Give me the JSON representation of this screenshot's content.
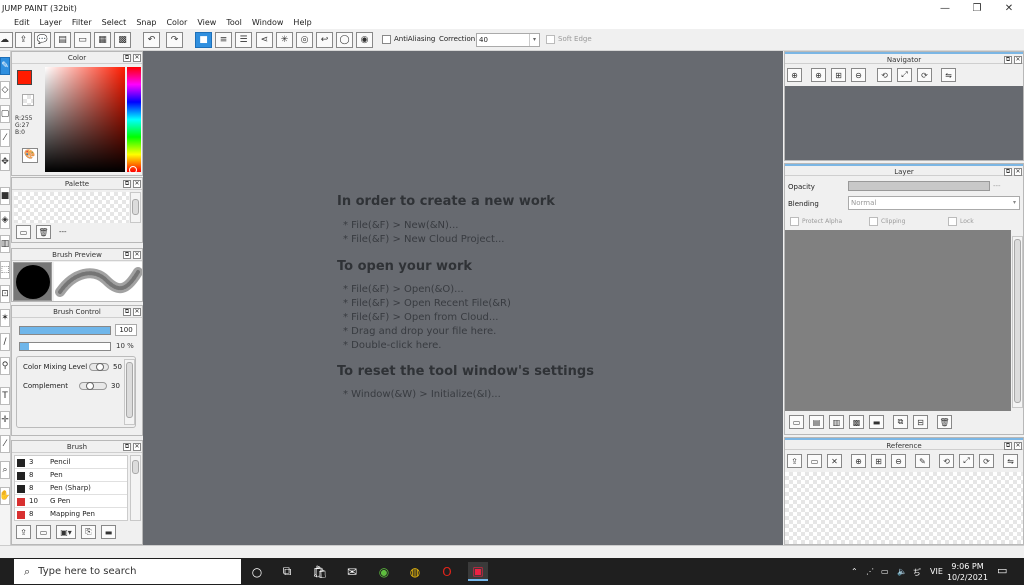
{
  "window": {
    "title": "JUMP PAINT (32bit)",
    "controls": [
      "—",
      "❐",
      "✕"
    ]
  },
  "menu": [
    "Edit",
    "Layer",
    "Filter",
    "Select",
    "Snap",
    "Color",
    "View",
    "Tool",
    "Window",
    "Help"
  ],
  "toolbar": {
    "antialiasing_label": "AntiAliasing",
    "correction_label": "Correction",
    "correction_value": "40",
    "soft_edge_label": "Soft Edge"
  },
  "color_panel": {
    "title": "Color",
    "rgb": {
      "r": "R:255",
      "g": "G:27",
      "b": "B:0"
    },
    "fg_color": "#ff1b00"
  },
  "palette_panel": {
    "title": "Palette",
    "menu_text": "---"
  },
  "brush_preview_panel": {
    "title": "Brush Preview"
  },
  "brush_control_panel": {
    "title": "Brush Control",
    "size_value": "100",
    "size_fill": 1.0,
    "opacity_value": "10 %",
    "opacity_fill": 0.1,
    "color_mixing_label": "Color Mixing Level",
    "color_mixing_value": "50",
    "color_mixing_level": 0.5,
    "complement_label": "Complement",
    "complement_value": "30",
    "complement_level": 0.3
  },
  "brush_panel": {
    "title": "Brush",
    "items": [
      {
        "size": "3",
        "name": "Pencil",
        "color": "#222222"
      },
      {
        "size": "8",
        "name": "Pen",
        "color": "#222222"
      },
      {
        "size": "8",
        "name": "Pen (Sharp)",
        "color": "#222222"
      },
      {
        "size": "10",
        "name": "G Pen",
        "color": "#d83030"
      },
      {
        "size": "8",
        "name": "Mapping Pen",
        "color": "#d83030"
      }
    ]
  },
  "canvas_help": {
    "heading1": "In order to create a new work",
    "items1": [
      "* File(&F) > New(&N)...",
      "* File(&F) > New Cloud Project..."
    ],
    "heading2": "To open your work",
    "items2": [
      "* File(&F) > Open(&O)...",
      "* File(&F) > Open Recent File(&R)",
      "* File(&F) > Open from Cloud...",
      "* Drag and drop your file here.",
      "* Double-click here."
    ],
    "heading3": "To reset the tool window's settings",
    "items3": [
      "* Window(&W) > Initialize(&I)..."
    ]
  },
  "navigator_panel": {
    "title": "Navigator"
  },
  "layer_panel": {
    "title": "Layer",
    "opacity_label": "Opacity",
    "opacity_value": "---",
    "blending_label": "Blending",
    "blending_value": "Normal",
    "protect_alpha_label": "Protect Alpha",
    "clipping_label": "Clipping",
    "lock_label": "Lock"
  },
  "reference_panel": {
    "title": "Reference"
  },
  "taskbar": {
    "search_placeholder": "Type here to search",
    "language": "VIE",
    "time": "9:06 PM",
    "date": "10/2/2021"
  }
}
